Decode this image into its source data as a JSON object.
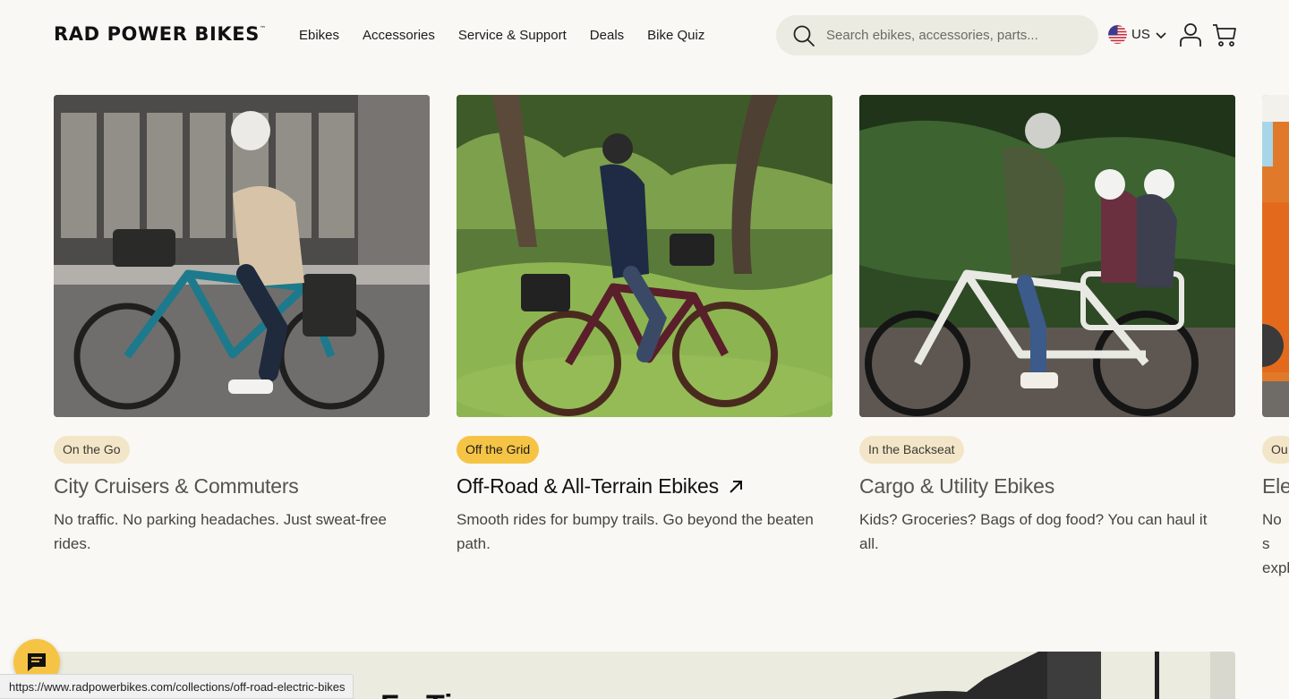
{
  "header": {
    "logo": "RAD POWER BIKES",
    "logo_tm": "™",
    "nav": [
      "Ebikes",
      "Accessories",
      "Service & Support",
      "Deals",
      "Bike Quiz"
    ],
    "search_placeholder": "Search ebikes, accessories, parts...",
    "region": "US"
  },
  "cards": [
    {
      "tag": "On the Go",
      "title": "City Cruisers & Commuters",
      "description": "No traffic. No parking headaches. Just sweat-free rides.",
      "highlighted": false
    },
    {
      "tag": "Off the Grid",
      "title": "Off-Road & All-Terrain Ebikes",
      "description": "Smooth rides for bumpy trails. Go beyond the beaten path.",
      "highlighted": true
    },
    {
      "tag": "In the Backseat",
      "title": "Cargo & Utility Ebikes",
      "description": "Kids? Groceries? Bags of dog food? You can haul it all.",
      "highlighted": false
    },
    {
      "tag": "Ou",
      "title": "Ele",
      "description": "No s expl",
      "highlighted": false
    }
  ],
  "promo": {
    "heading": "Fo Ti"
  },
  "status_bar": {
    "url": "https://www.radpowerbikes.com/collections/off-road-electric-bikes"
  },
  "colors": {
    "background": "#f9f8f4",
    "accent_yellow": "#f6c445",
    "tag_bg": "#f3e6c8",
    "search_bg": "#ecebe1"
  },
  "icons": {
    "search": "search-icon",
    "flag": "us-flag-icon",
    "region_chevron": "chevron-down-icon",
    "account": "account-icon",
    "cart": "cart-icon",
    "link_arrow": "arrow-up-right-icon",
    "chat": "chat-icon"
  }
}
